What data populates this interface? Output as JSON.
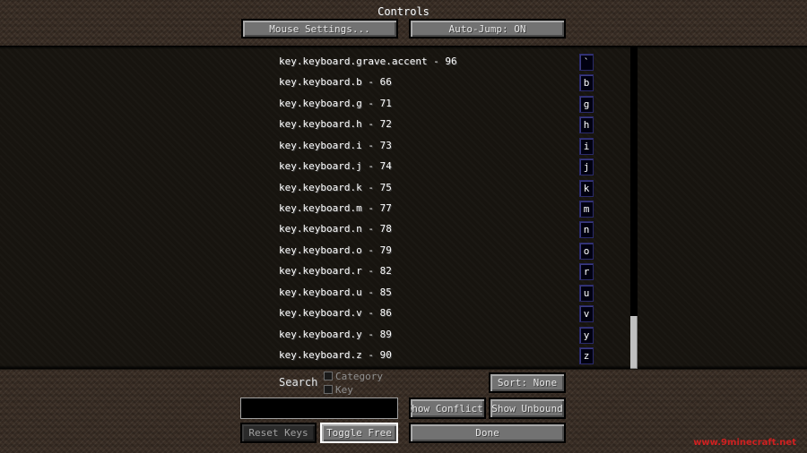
{
  "window": {
    "title": "Controls"
  },
  "top_buttons": {
    "mouse_settings": "Mouse Settings...",
    "auto_jump": "Auto-Jump: ON"
  },
  "bindings": [
    {
      "label": "key.keyboard.grave.accent - 96",
      "key": "`"
    },
    {
      "label": "key.keyboard.b - 66",
      "key": "b"
    },
    {
      "label": "key.keyboard.g - 71",
      "key": "g"
    },
    {
      "label": "key.keyboard.h - 72",
      "key": "h"
    },
    {
      "label": "key.keyboard.i - 73",
      "key": "i"
    },
    {
      "label": "key.keyboard.j - 74",
      "key": "j"
    },
    {
      "label": "key.keyboard.k - 75",
      "key": "k"
    },
    {
      "label": "key.keyboard.m - 77",
      "key": "m"
    },
    {
      "label": "key.keyboard.n - 78",
      "key": "n"
    },
    {
      "label": "key.keyboard.o - 79",
      "key": "o"
    },
    {
      "label": "key.keyboard.r - 82",
      "key": "r"
    },
    {
      "label": "key.keyboard.u - 85",
      "key": "u"
    },
    {
      "label": "key.keyboard.v - 86",
      "key": "v"
    },
    {
      "label": "key.keyboard.y - 89",
      "key": "y"
    },
    {
      "label": "key.keyboard.z - 90",
      "key": "z"
    }
  ],
  "search": {
    "label": "Search",
    "value": "",
    "options": {
      "category": "Category",
      "key": "Key"
    }
  },
  "buttons": {
    "sort": "Sort: None",
    "show_conflicts": "Show Conflicts",
    "show_unbound": "Show Unbound",
    "reset_keys": "Reset Keys",
    "toggle_free": "Toggle Free",
    "done": "Done"
  },
  "watermark": "www.9minecraft.net"
}
